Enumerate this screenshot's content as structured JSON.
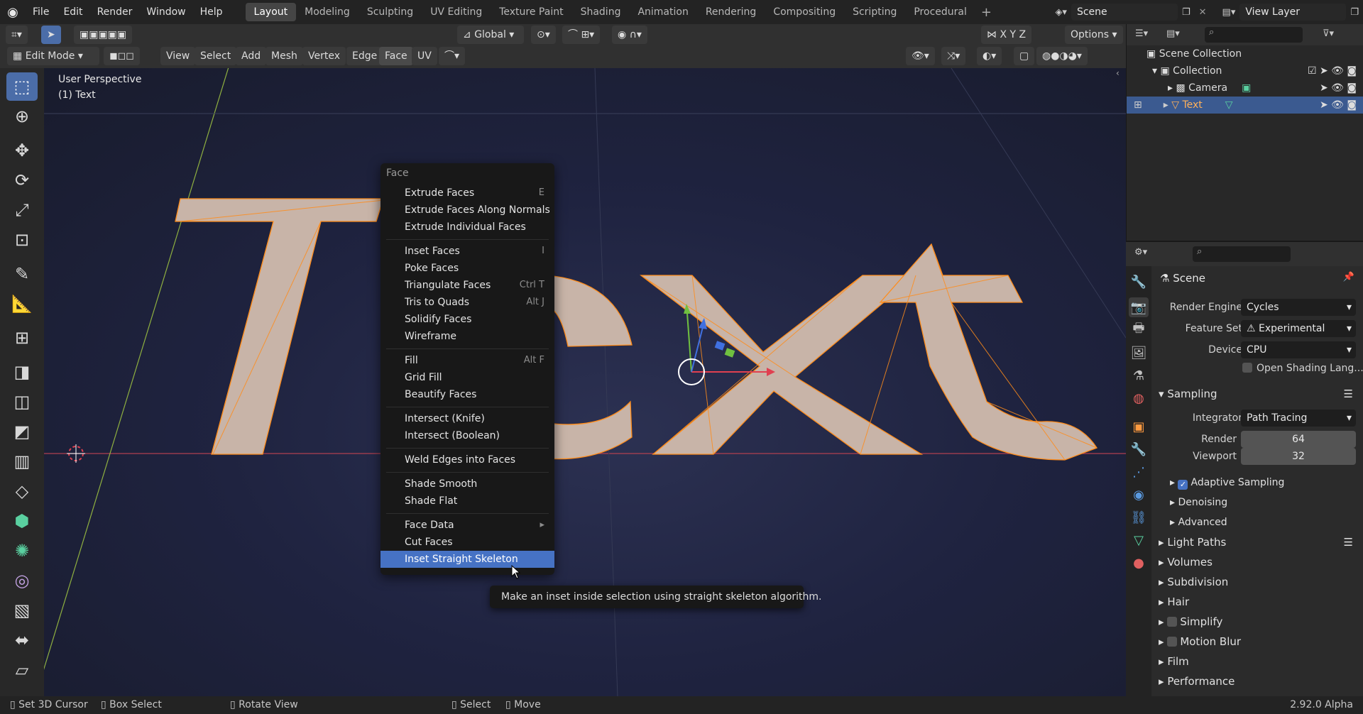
{
  "topbar": {
    "menus": [
      "File",
      "Edit",
      "Render",
      "Window",
      "Help"
    ],
    "workspaces": [
      "Layout",
      "Modeling",
      "Sculpting",
      "UV Editing",
      "Texture Paint",
      "Shading",
      "Animation",
      "Rendering",
      "Compositing",
      "Scripting",
      "Procedural"
    ],
    "scene": "Scene",
    "view_layer": "View Layer"
  },
  "header": {
    "transform_orientation": "Global",
    "options_label": "Options",
    "axes": [
      "X",
      "Y",
      "Z"
    ],
    "mode": "Edit Mode",
    "menus": [
      "View",
      "Select",
      "Add",
      "Mesh",
      "Vertex",
      "Edge",
      "Face",
      "UV"
    ]
  },
  "viewport": {
    "view_name": "User Perspective",
    "object_label": "(1) Text"
  },
  "face_menu": {
    "title": "Face",
    "groups": [
      [
        {
          "label": "Extrude Faces",
          "shortcut": "E"
        },
        {
          "label": "Extrude Faces Along Normals",
          "shortcut": ""
        },
        {
          "label": "Extrude Individual Faces",
          "shortcut": ""
        }
      ],
      [
        {
          "label": "Inset Faces",
          "shortcut": "I"
        },
        {
          "label": "Poke Faces",
          "shortcut": ""
        },
        {
          "label": "Triangulate Faces",
          "shortcut": "Ctrl T"
        },
        {
          "label": "Tris to Quads",
          "shortcut": "Alt J"
        },
        {
          "label": "Solidify Faces",
          "shortcut": ""
        },
        {
          "label": "Wireframe",
          "shortcut": ""
        }
      ],
      [
        {
          "label": "Fill",
          "shortcut": "Alt F"
        },
        {
          "label": "Grid Fill",
          "shortcut": ""
        },
        {
          "label": "Beautify Faces",
          "shortcut": ""
        }
      ],
      [
        {
          "label": "Intersect (Knife)",
          "shortcut": ""
        },
        {
          "label": "Intersect (Boolean)",
          "shortcut": ""
        }
      ],
      [
        {
          "label": "Weld Edges into Faces",
          "shortcut": ""
        }
      ],
      [
        {
          "label": "Shade Smooth",
          "shortcut": ""
        },
        {
          "label": "Shade Flat",
          "shortcut": ""
        }
      ],
      [
        {
          "label": "Face Data",
          "shortcut": "▸"
        },
        {
          "label": "Cut Faces",
          "shortcut": ""
        },
        {
          "label": "Inset Straight Skeleton",
          "shortcut": ""
        }
      ]
    ],
    "highlighted": "Inset Straight Skeleton",
    "tooltip": "Make an inset inside selection using straight skeleton algorithm."
  },
  "outliner": {
    "root": "Scene Collection",
    "collection": "Collection",
    "items": [
      "Camera",
      "Text"
    ]
  },
  "properties": {
    "context": "Scene",
    "render_engine_label": "Render Engine",
    "render_engine": "Cycles",
    "feature_set_label": "Feature Set",
    "feature_set": "Experimental",
    "device_label": "Device",
    "device": "CPU",
    "osl_label": "Open Shading Lang...",
    "sampling": {
      "title": "Sampling",
      "integrator_label": "Integrator",
      "integrator": "Path Tracing",
      "render_label": "Render",
      "render": "64",
      "viewport_label": "Viewport",
      "viewport": "32",
      "subpanels": [
        "Adaptive Sampling",
        "Denoising",
        "Advanced"
      ]
    },
    "panels": [
      "Light Paths",
      "Volumes",
      "Subdivision",
      "Hair",
      "Simplify",
      "Motion Blur",
      "Film",
      "Performance"
    ]
  },
  "statusbar": {
    "items": [
      "Set 3D Cursor",
      "Box Select",
      "Rotate View",
      "Select",
      "Move"
    ],
    "version": "2.92.0 Alpha"
  },
  "colors": {
    "accent": "#4672c4",
    "selection": "#ff8c1a",
    "face": "#c8b4a8"
  }
}
